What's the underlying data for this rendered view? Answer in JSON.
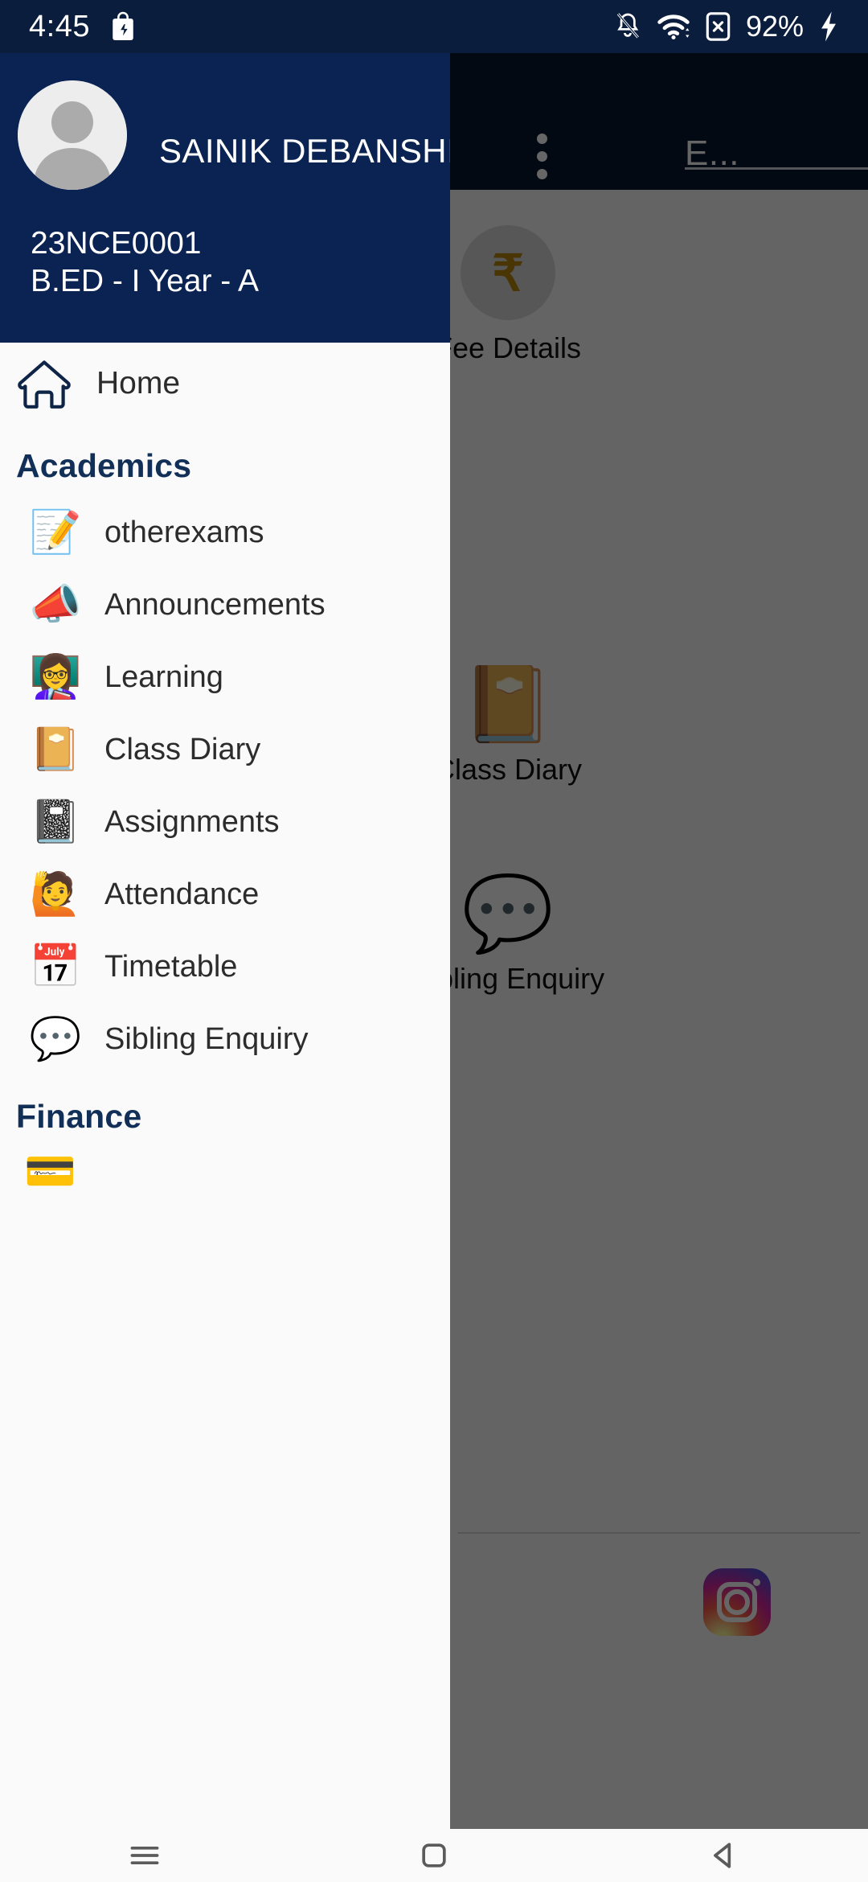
{
  "status_bar": {
    "time": "4:45",
    "app_icon": "shopping-bag-icon",
    "notifications_silenced_icon": "bell-off-icon",
    "wifi_icon": "wifi-icon",
    "sim_icon": "no-sim-icon",
    "battery_percent": "92%",
    "charging_icon": "charging-bolt-icon"
  },
  "background_app": {
    "appbar_title": "E...",
    "overflow_icon": "three-dot-menu-icon",
    "tiles": [
      {
        "label": "Fee Details",
        "icon": "rupee-coin-icon",
        "glyph": "₹"
      },
      {
        "label": "Class Diary",
        "icon": "notebook-pen-icon",
        "glyph": "📔"
      },
      {
        "label": "Sibling Enquiry",
        "icon": "speech-bubbles-icon",
        "glyph": "💬"
      }
    ],
    "social_icon": "instagram-icon"
  },
  "drawer": {
    "profile": {
      "avatar_icon": "person-avatar-icon",
      "name": "SAINIK DEBANSHI",
      "student_id": "23NCE0001",
      "class_info": "B.ED - I Year - A"
    },
    "home": {
      "label": "Home",
      "icon": "home-icon"
    },
    "sections": [
      {
        "title": "Academics",
        "items": [
          {
            "label": "otherexams",
            "icon": "exam-checklist-icon",
            "glyph": "📝"
          },
          {
            "label": "Announcements",
            "icon": "megaphone-icon",
            "glyph": "📣"
          },
          {
            "label": "Learning",
            "icon": "teacher-class-icon",
            "glyph": "👩‍🏫"
          },
          {
            "label": "Class Diary",
            "icon": "notebook-pen-icon",
            "glyph": "📔"
          },
          {
            "label": "Assignments",
            "icon": "notebook-pencil-icon",
            "glyph": "📓"
          },
          {
            "label": "Attendance",
            "icon": "raised-hands-icon",
            "glyph": "🙋"
          },
          {
            "label": "Timetable",
            "icon": "calendar-clock-icon",
            "glyph": "📅"
          },
          {
            "label": "Sibling Enquiry",
            "icon": "speech-bubbles-icon",
            "glyph": "💬"
          }
        ]
      },
      {
        "title": "Finance",
        "items": [
          {
            "label": "",
            "icon": "fee-card-icon",
            "glyph": "💳"
          }
        ]
      }
    ]
  },
  "nav_bar": {
    "recents_label": "recents-button",
    "home_label": "home-button",
    "back_label": "back-button"
  },
  "colors": {
    "status_bar_bg": "#0a1d3d",
    "drawer_header_bg": "#0b2352",
    "drawer_bg": "#fafafa",
    "section_title": "#123057",
    "scrim": "rgba(0,0,0,0.60)"
  }
}
